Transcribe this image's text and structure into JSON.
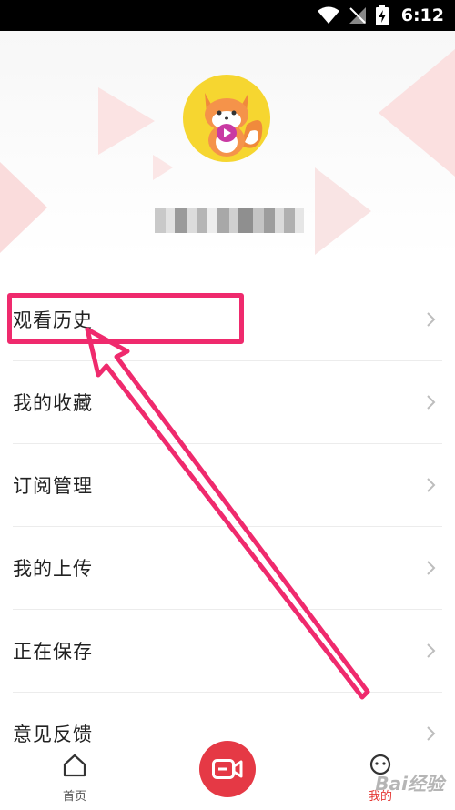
{
  "status_bar": {
    "time": "6:12"
  },
  "profile": {
    "username": ""
  },
  "menu": {
    "items": [
      {
        "label": "观看历史"
      },
      {
        "label": "我的收藏"
      },
      {
        "label": "订阅管理"
      },
      {
        "label": "我的上传"
      },
      {
        "label": "正在保存"
      },
      {
        "label": "意见反馈"
      }
    ]
  },
  "bottom_nav": {
    "home_label": "首页",
    "mine_label": "我的"
  },
  "watermark": {
    "text": "Bai经验"
  },
  "colors": {
    "accent": "#e53945",
    "annotation": "#ef2a6d",
    "avatar_bg": "#f6d630"
  }
}
